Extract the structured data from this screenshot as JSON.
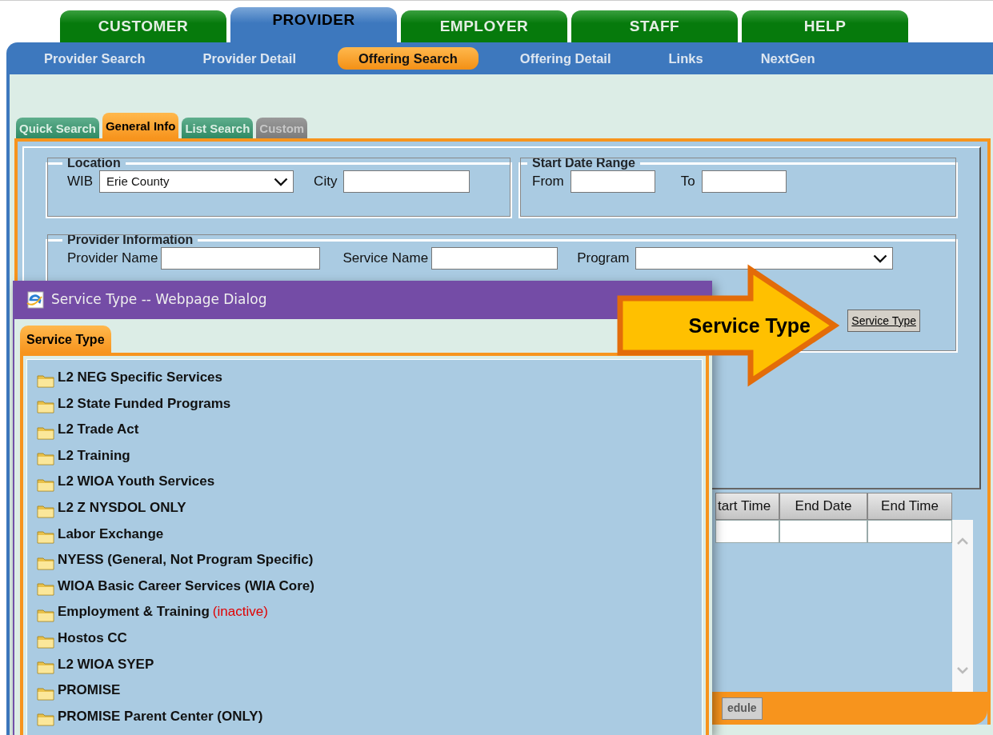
{
  "top_tabs": [
    {
      "label": "CUSTOMER",
      "selected": false
    },
    {
      "label": "PROVIDER",
      "selected": true
    },
    {
      "label": "EMPLOYER",
      "selected": false
    },
    {
      "label": "STAFF",
      "selected": false
    },
    {
      "label": "HELP",
      "selected": false
    }
  ],
  "sub_nav": [
    {
      "label": "Provider Search",
      "selected": false
    },
    {
      "label": "Provider Detail",
      "selected": false
    },
    {
      "label": "Offering Search",
      "selected": true
    },
    {
      "label": "Offering Detail",
      "selected": false
    },
    {
      "label": "Links",
      "selected": false
    },
    {
      "label": "NextGen",
      "selected": false
    }
  ],
  "page_tabs": [
    {
      "label": "Quick Search",
      "selected": false,
      "disabled": false
    },
    {
      "label": "General Info",
      "selected": true,
      "disabled": false
    },
    {
      "label": "List Search",
      "selected": false,
      "disabled": false
    },
    {
      "label": "Custom",
      "selected": false,
      "disabled": true
    }
  ],
  "location": {
    "legend": "Location",
    "wib": {
      "label": "WIB",
      "value": "Erie County"
    },
    "city": {
      "label": "City"
    }
  },
  "start_date_range": {
    "legend": "Start Date Range",
    "from": {
      "label": "From"
    },
    "to": {
      "label": "To"
    }
  },
  "provider_information": {
    "legend": "Provider Information",
    "provider_name": {
      "label": "Provider Name"
    },
    "service_name": {
      "label": "Service Name"
    },
    "program": {
      "label": "Program"
    },
    "service_type_button": "Service Type"
  },
  "results_table": {
    "columns": [
      "tart Time",
      "End Date",
      "End Time"
    ]
  },
  "footer_button": {
    "label": "edule",
    "disabled": true
  },
  "dialog": {
    "title": "Service Type -- Webpage Dialog",
    "tab": "Service Type",
    "items": [
      {
        "label": "L2 NEG Specific Services"
      },
      {
        "label": "L2 State Funded Programs"
      },
      {
        "label": "L2 Trade Act"
      },
      {
        "label": "L2 Training"
      },
      {
        "label": "L2 WIOA Youth Services"
      },
      {
        "label": "L2 Z NYSDOL ONLY"
      },
      {
        "label": "Labor Exchange"
      },
      {
        "label": "NYESS (General, Not Program Specific)"
      },
      {
        "label": "WIOA Basic Career Services (WIA Core)"
      },
      {
        "label": "Employment & Training",
        "note": "(inactive)"
      },
      {
        "label": "Hostos CC"
      },
      {
        "label": "L2 WIOA SYEP"
      },
      {
        "label": "PROMISE"
      },
      {
        "label": "PROMISE Parent Center (ONLY)"
      }
    ]
  },
  "callout": {
    "text": "Service Type"
  }
}
